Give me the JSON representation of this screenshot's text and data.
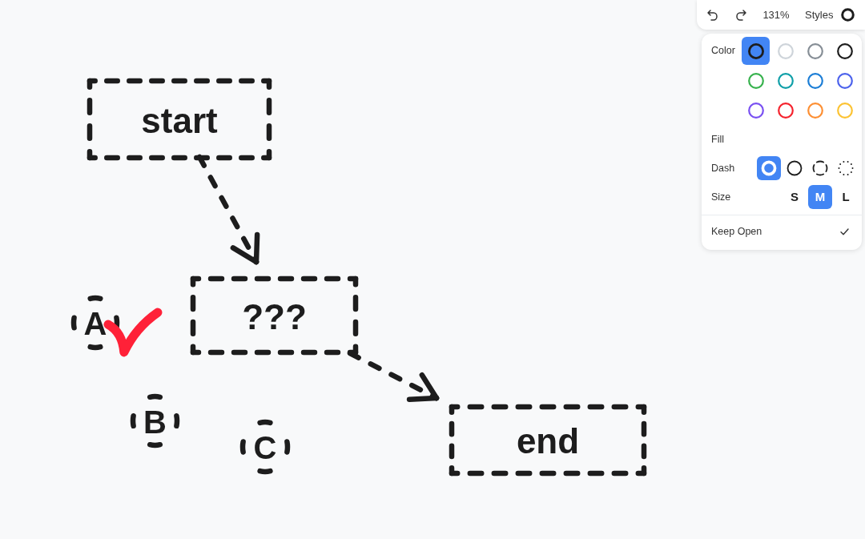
{
  "canvas": {
    "shapes": [
      {
        "kind": "rectangle",
        "label": "start",
        "color": "#1d1d1d"
      },
      {
        "kind": "arrow",
        "color": "#1d1d1d"
      },
      {
        "kind": "rectangle",
        "label": "???",
        "color": "#1d1d1d"
      },
      {
        "kind": "arrow",
        "color": "#1d1d1d"
      },
      {
        "kind": "rectangle",
        "label": "end",
        "color": "#1d1d1d"
      },
      {
        "kind": "ellipse",
        "label": "A",
        "color": "#1d1d1d"
      },
      {
        "kind": "freehand",
        "color": "#ff2138"
      },
      {
        "kind": "ellipse",
        "label": "B",
        "color": "#1d1d1d"
      },
      {
        "kind": "ellipse",
        "label": "C",
        "color": "#1d1d1d"
      }
    ]
  },
  "toolbar": {
    "zoom": "131%",
    "styles_label": "Styles"
  },
  "style_panel": {
    "color_label": "Color",
    "colors": [
      {
        "color": "#1d1d1d",
        "selected": true
      },
      {
        "color": "#ced4da",
        "selected": false
      },
      {
        "color": "#868e96",
        "selected": false
      },
      {
        "color": "#1d1d1d",
        "selected": false
      },
      {
        "color": "#37b24d",
        "selected": false
      },
      {
        "color": "#0f9fa8",
        "selected": false
      },
      {
        "color": "#1c7ed6",
        "selected": false
      },
      {
        "color": "#4c62ec",
        "selected": false
      },
      {
        "color": "#7950f2",
        "selected": false
      },
      {
        "color": "#f5222d",
        "selected": false
      },
      {
        "color": "#fd8f33",
        "selected": false
      },
      {
        "color": "#fcc333",
        "selected": false
      }
    ],
    "fill_label": "Fill",
    "dash_label": "Dash",
    "dash_options": [
      {
        "kind": "draw",
        "selected": true
      },
      {
        "kind": "solid",
        "selected": false
      },
      {
        "kind": "dashed",
        "selected": false
      },
      {
        "kind": "dotted",
        "selected": false
      }
    ],
    "size_label": "Size",
    "size_options": [
      {
        "label": "S",
        "selected": false
      },
      {
        "label": "M",
        "selected": true
      },
      {
        "label": "L",
        "selected": false
      }
    ],
    "keep_open": {
      "label": "Keep Open",
      "checked": true
    }
  }
}
